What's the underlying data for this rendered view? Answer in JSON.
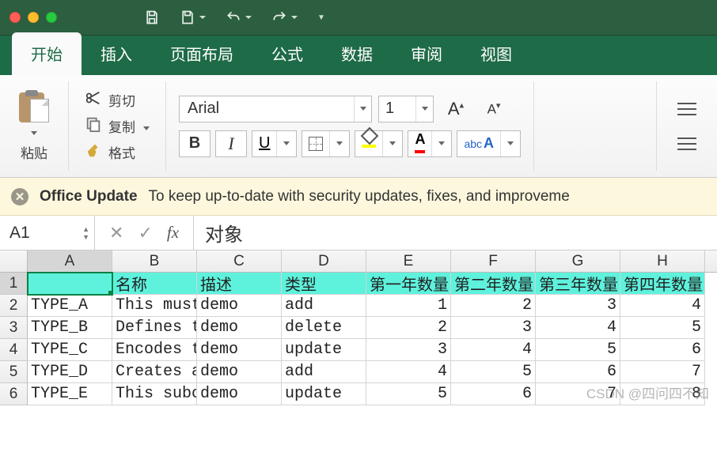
{
  "qat": {
    "save_alt": "save",
    "undo_alt": "undo",
    "redo_alt": "redo"
  },
  "tabs": [
    "开始",
    "插入",
    "页面布局",
    "公式",
    "数据",
    "审阅",
    "视图"
  ],
  "active_tab": 0,
  "clipboard": {
    "paste": "粘贴",
    "cut": "剪切",
    "copy": "复制",
    "format": "格式"
  },
  "font": {
    "name": "Arial",
    "size": "1",
    "bold": "B",
    "italic": "I",
    "underline": "U"
  },
  "notice": {
    "title": "Office Update",
    "body": "To keep up-to-date with security updates, fixes, and improveme"
  },
  "namebox": "A1",
  "fx": "fx",
  "formula": "对象",
  "columns": [
    "A",
    "B",
    "C",
    "D",
    "E",
    "F",
    "G",
    "H"
  ],
  "row_nums": [
    "1",
    "2",
    "3",
    "4",
    "5",
    "6"
  ],
  "header_row": [
    "",
    "名称",
    "描述",
    "类型",
    "第一年数量",
    "第二年数量",
    "第三年数量",
    "第四年数量"
  ],
  "data_rows": [
    [
      "TYPE_A",
      "This must",
      "demo",
      "add",
      "1",
      "2",
      "3",
      "4"
    ],
    [
      "TYPE_B",
      "Defines t",
      "demo",
      "delete",
      "2",
      "3",
      "4",
      "5"
    ],
    [
      "TYPE_C",
      "Encodes t",
      "demo",
      "update",
      "3",
      "4",
      "5",
      "6"
    ],
    [
      "TYPE_D",
      "Creates a",
      "demo",
      "add",
      "4",
      "5",
      "6",
      "7"
    ],
    [
      "TYPE_E",
      "This subc",
      "demo",
      "update",
      "5",
      "6",
      "7",
      "8"
    ]
  ],
  "watermark": "CSDN @四问四不知"
}
